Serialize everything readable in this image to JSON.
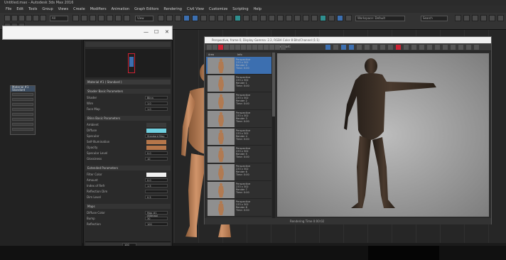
{
  "window": {
    "title": "Untitled.max - Autodesk 3ds Max 2016"
  },
  "menu": [
    "File",
    "Edit",
    "Tools",
    "Group",
    "Views",
    "Create",
    "Modifiers",
    "Animation",
    "Graph Editors",
    "Rendering",
    "Civil View",
    "Customize",
    "Scripting",
    "Help"
  ],
  "toolbar": {
    "selection_filter": "All",
    "view_dropdown": "View",
    "workspace": "Workspace: Default",
    "search": "Search"
  },
  "dialog": {
    "minimize": "—",
    "maximize": "☐",
    "close": "✕"
  },
  "left_panel": {
    "node_title": "Material #1",
    "node_subtitle": "Standard",
    "node_pins": [
      "Diffuse",
      "Specular",
      "Glossiness",
      "Opacity",
      "Bump",
      "Reflection",
      "Refraction",
      "Displace"
    ]
  },
  "material_panel": {
    "header": "Material #1 ( Standard )",
    "sections": [
      {
        "title": "Shader Basic Parameters",
        "rows": [
          {
            "label": "Shader",
            "value": "Blinn"
          },
          {
            "label": "Wire",
            "value": "1.0"
          },
          {
            "label": "Face Map",
            "value": "1.0"
          }
        ]
      },
      {
        "title": "Blinn Basic Parameters",
        "rows": [
          {
            "label": "Ambient",
            "color": "#3a3a3a"
          },
          {
            "label": "Diffuse",
            "color": "#6fd0e0"
          },
          {
            "label": "Specular",
            "value": "Standard Map"
          },
          {
            "label": "Self-Illumination",
            "color": "#b5764a"
          },
          {
            "label": "Opacity",
            "color": "#b5764a"
          },
          {
            "label": "Specular Level",
            "value": "0.0"
          },
          {
            "label": "Glossiness",
            "value": "10"
          }
        ]
      },
      {
        "title": "Extended Parameters",
        "rows": [
          {
            "label": "Filter Color",
            "color": "#f0f0f0"
          },
          {
            "label": "Amount",
            "value": "0.0"
          },
          {
            "label": "Index of Refr",
            "value": "1.5"
          },
          {
            "label": "Reflection Dim",
            "value": ""
          },
          {
            "label": "Dim Level",
            "value": "0.5"
          }
        ]
      },
      {
        "title": "Maps",
        "rows": [
          {
            "label": "Diffuse Color",
            "value": "Map #1 (Bitmap)"
          },
          {
            "label": "Bump",
            "value": "30"
          },
          {
            "label": "Reflection",
            "value": "100"
          }
        ]
      }
    ],
    "footer_value": "100"
  },
  "render_window": {
    "title": "Perspective, frame 0, Display Gamma: 2.2, RGBA Color 8 Bits/Channel (1:1)",
    "area_label": "Viewport:",
    "list_header": [
      "Area",
      "Info"
    ],
    "thumbs": [
      {
        "text": "Perspective\n233 x 302\nRender 0\nTime: 0:00"
      },
      {
        "text": "Perspective\n233 x 302\nRender 1\nTime: 0:00"
      },
      {
        "text": "Perspective\n233 x 302\nRender 2\nTime: 0:00"
      },
      {
        "text": "Perspective\n233 x 302\nRender 3\nTime: 0:00"
      },
      {
        "text": "Perspective\n233 x 302\nRender 4\nTime: 0:00"
      },
      {
        "text": "Perspective\n233 x 302\nRender 5\nTime: 0:00"
      },
      {
        "text": "Perspective\n233 x 302\nRender 6\nTime: 0:00"
      },
      {
        "text": "Perspective\n233 x 302\nRender 7\nTime: 0:00"
      },
      {
        "text": "Perspective\n233 x 302\nRender 8\nTime: 0:00"
      }
    ],
    "status": "Rendering Time 0:00:02"
  },
  "colors": {
    "accent_blue": "#3c6fb0",
    "selected_row": "#3c6fb0",
    "render_bg": "#9e9e9e"
  }
}
